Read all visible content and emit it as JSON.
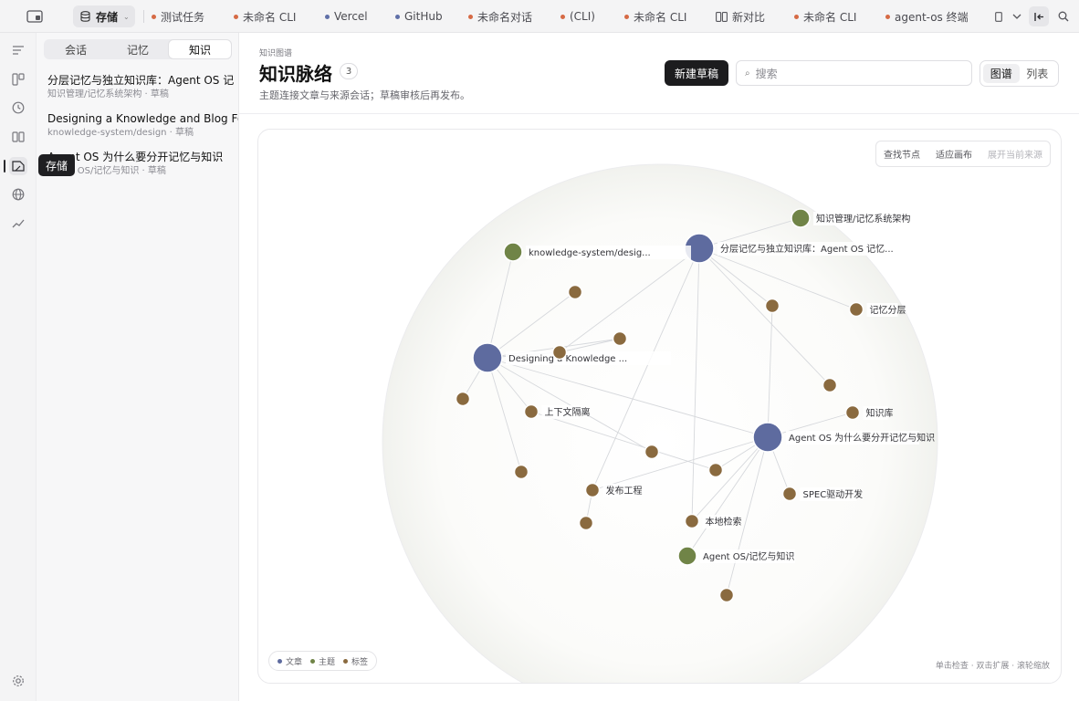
{
  "topbar": {
    "store_label": "存储",
    "tabs": [
      {
        "label": "测试任务",
        "color": "#d66a45"
      },
      {
        "label": "未命名 CLI",
        "color": "#d66a45"
      },
      {
        "label": "Vercel",
        "color": "#5f6fa8"
      },
      {
        "label": "GitHub",
        "color": "#5f6fa8"
      },
      {
        "label": "未命名对话",
        "color": "#d66a45"
      },
      {
        "label": "(CLI)",
        "color": "#d66a45"
      },
      {
        "label": "未命名 CLI",
        "color": "#d66a45"
      },
      {
        "label": "新对比",
        "color": ""
      },
      {
        "label": "未命名 CLI",
        "color": "#d66a45"
      },
      {
        "label": "agent-os 终端",
        "color": "#d66a45"
      }
    ]
  },
  "rail": {
    "tooltip": "存储"
  },
  "panel": {
    "segments": [
      "会话",
      "记忆",
      "知识"
    ],
    "active_segment": "知识",
    "items": [
      {
        "title": "分层记忆与独立知识库：Agent OS 记",
        "meta": "知识管理/记忆系统架构 · 草稿"
      },
      {
        "title": "Designing a Knowledge and Blog Fo",
        "meta": "knowledge-system/design · 草稿"
      },
      {
        "title": "Agent OS 为什么要分开记忆与知识",
        "meta": "Agent OS/记忆与知识 · 草稿"
      }
    ]
  },
  "main": {
    "breadcrumb": "知识图谱",
    "title": "知识脉络",
    "count": "3",
    "subtitle": "主题连接文章与来源会话；草稿审核后再发布。",
    "new_draft": "新建草稿",
    "search_placeholder": "搜索",
    "view_graph": "图谱",
    "view_list": "列表"
  },
  "canvas": {
    "tools": {
      "find": "查找节点",
      "fit": "适应画布",
      "expand": "展开当前来源"
    },
    "legend": {
      "article": "文章",
      "topic": "主题",
      "tag": "标签"
    },
    "hint": "单击检查 · 双击扩展 · 滚轮缩放"
  },
  "colors": {
    "article": "#5e6b9f",
    "topic": "#708447",
    "tag": "#8a6a3f"
  },
  "graph": {
    "nodes": [
      {
        "id": "a1",
        "type": "article",
        "label": "分层记忆与独立知识库：Agent OS 记忆..."
      },
      {
        "id": "a2",
        "type": "article",
        "label": "Designing a Knowledge ..."
      },
      {
        "id": "a3",
        "type": "article",
        "label": "Agent OS 为什么要分开记忆与知识"
      },
      {
        "id": "t1",
        "type": "topic",
        "label": "知识管理/记忆系统架构"
      },
      {
        "id": "t2",
        "type": "topic",
        "label": "knowledge-system/desig..."
      },
      {
        "id": "t3",
        "type": "topic",
        "label": "Agent OS/记忆与知识"
      },
      {
        "id": "g1",
        "type": "tag",
        "label": "记忆分层"
      },
      {
        "id": "g2",
        "type": "tag",
        "label": "知识库"
      },
      {
        "id": "g3",
        "type": "tag",
        "label": "上下文隔离"
      },
      {
        "id": "g4",
        "type": "tag",
        "label": "发布工程"
      },
      {
        "id": "g5",
        "type": "tag",
        "label": "SPEC驱动开发"
      },
      {
        "id": "g6",
        "type": "tag",
        "label": "本地检索"
      },
      {
        "id": "g7",
        "type": "tag",
        "label": ""
      },
      {
        "id": "g8",
        "type": "tag",
        "label": ""
      },
      {
        "id": "g9",
        "type": "tag",
        "label": ""
      },
      {
        "id": "g10",
        "type": "tag",
        "label": ""
      },
      {
        "id": "g11",
        "type": "tag",
        "label": ""
      },
      {
        "id": "g12",
        "type": "tag",
        "label": ""
      },
      {
        "id": "g13",
        "type": "tag",
        "label": ""
      },
      {
        "id": "g14",
        "type": "tag",
        "label": ""
      },
      {
        "id": "g15",
        "type": "tag",
        "label": ""
      },
      {
        "id": "g16",
        "type": "tag",
        "label": ""
      },
      {
        "id": "g17",
        "type": "tag",
        "label": ""
      }
    ],
    "edges": [
      [
        "a1",
        "t1"
      ],
      [
        "a1",
        "g1"
      ],
      [
        "a1",
        "g13"
      ],
      [
        "a1",
        "g8"
      ],
      [
        "a1",
        "g14"
      ],
      [
        "a1",
        "g6"
      ],
      [
        "a1",
        "g4"
      ],
      [
        "a2",
        "t2"
      ],
      [
        "a2",
        "g7"
      ],
      [
        "a2",
        "g8"
      ],
      [
        "a2",
        "g9"
      ],
      [
        "a2",
        "g10"
      ],
      [
        "a2",
        "g3"
      ],
      [
        "a2",
        "g12"
      ],
      [
        "a2",
        "g17"
      ],
      [
        "a2",
        "a3"
      ],
      [
        "a3",
        "g2"
      ],
      [
        "a3",
        "g5"
      ],
      [
        "a3",
        "t3"
      ],
      [
        "a3",
        "g16"
      ],
      [
        "a3",
        "g4"
      ],
      [
        "a3",
        "g11"
      ],
      [
        "a3",
        "g6"
      ],
      [
        "a3",
        "g13"
      ],
      [
        "g3",
        "g11"
      ],
      [
        "g4",
        "g15"
      ],
      [
        "g9",
        "g8"
      ]
    ]
  }
}
